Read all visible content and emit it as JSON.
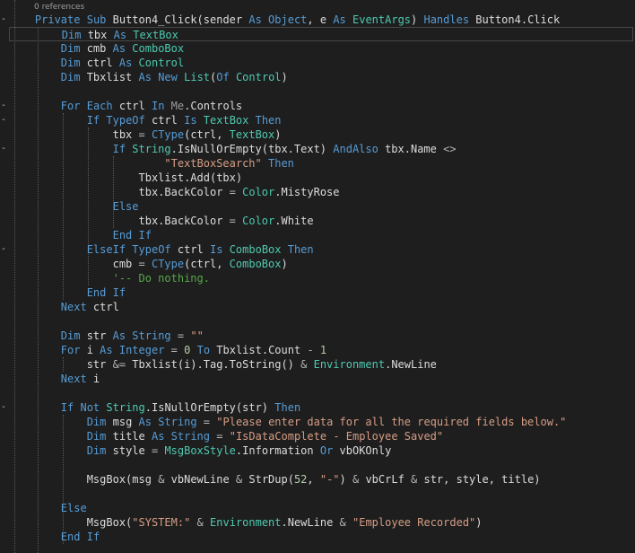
{
  "codelens": {
    "references": "0 references"
  },
  "colors": {
    "background": "#1e1e1e",
    "keyword": "#569cd6",
    "type": "#4ec9b0",
    "string": "#d69d85",
    "comment": "#57a64a",
    "number": "#b5cea8",
    "text": "#dcdcdc",
    "operator": "#b4b4b4"
  },
  "collapse_markers": [
    "-",
    "-",
    "-",
    "-",
    "-",
    "-"
  ],
  "code": {
    "lines": [
      {
        "indent": "    ",
        "tokens": [
          {
            "t": "Private",
            "c": "kw"
          },
          {
            "t": " "
          },
          {
            "t": "Sub",
            "c": "kw"
          },
          {
            "t": " Button4_Click(sender "
          },
          {
            "t": "As",
            "c": "kw"
          },
          {
            "t": " "
          },
          {
            "t": "Object",
            "c": "kw"
          },
          {
            "t": ", e "
          },
          {
            "t": "As",
            "c": "kw"
          },
          {
            "t": " "
          },
          {
            "t": "EventArgs",
            "c": "ty"
          },
          {
            "t": ") "
          },
          {
            "t": "Handles",
            "c": "kw"
          },
          {
            "t": " Button4.Click"
          }
        ]
      },
      {
        "indent": "        ",
        "current": true,
        "tokens": [
          {
            "t": "Dim",
            "c": "kw"
          },
          {
            "t": " tbx "
          },
          {
            "t": "As",
            "c": "kw"
          },
          {
            "t": " "
          },
          {
            "t": "TextBox",
            "c": "ty"
          }
        ]
      },
      {
        "indent": "        ",
        "tokens": [
          {
            "t": "Dim",
            "c": "kw"
          },
          {
            "t": " cmb "
          },
          {
            "t": "As",
            "c": "kw"
          },
          {
            "t": " "
          },
          {
            "t": "ComboBox",
            "c": "ty"
          }
        ]
      },
      {
        "indent": "        ",
        "tokens": [
          {
            "t": "Dim",
            "c": "kw"
          },
          {
            "t": " ctrl "
          },
          {
            "t": "As",
            "c": "kw"
          },
          {
            "t": " "
          },
          {
            "t": "Control",
            "c": "ty"
          }
        ]
      },
      {
        "indent": "        ",
        "tokens": [
          {
            "t": "Dim",
            "c": "kw"
          },
          {
            "t": " Tbxlist "
          },
          {
            "t": "As",
            "c": "kw"
          },
          {
            "t": " "
          },
          {
            "t": "New",
            "c": "kw"
          },
          {
            "t": " "
          },
          {
            "t": "List",
            "c": "ty"
          },
          {
            "t": "("
          },
          {
            "t": "Of",
            "c": "kw"
          },
          {
            "t": " "
          },
          {
            "t": "Control",
            "c": "ty"
          },
          {
            "t": ")"
          }
        ]
      },
      {
        "indent": "",
        "tokens": []
      },
      {
        "indent": "        ",
        "tokens": [
          {
            "t": "For",
            "c": "kw"
          },
          {
            "t": " "
          },
          {
            "t": "Each",
            "c": "kw"
          },
          {
            "t": " ctrl "
          },
          {
            "t": "In",
            "c": "kw"
          },
          {
            "t": " "
          },
          {
            "t": "Me",
            "c": "me"
          },
          {
            "t": ".Controls"
          }
        ]
      },
      {
        "indent": "            ",
        "tokens": [
          {
            "t": "If",
            "c": "kw"
          },
          {
            "t": " "
          },
          {
            "t": "TypeOf",
            "c": "kw"
          },
          {
            "t": " ctrl "
          },
          {
            "t": "Is",
            "c": "kw"
          },
          {
            "t": " "
          },
          {
            "t": "TextBox",
            "c": "ty"
          },
          {
            "t": " "
          },
          {
            "t": "Then",
            "c": "kw"
          }
        ]
      },
      {
        "indent": "                ",
        "tokens": [
          {
            "t": "tbx "
          },
          {
            "t": "=",
            "c": "op"
          },
          {
            "t": " "
          },
          {
            "t": "CType",
            "c": "kw"
          },
          {
            "t": "(ctrl, "
          },
          {
            "t": "TextBox",
            "c": "ty"
          },
          {
            "t": ")"
          }
        ]
      },
      {
        "indent": "                ",
        "tokens": [
          {
            "t": "If",
            "c": "kw"
          },
          {
            "t": " "
          },
          {
            "t": "String",
            "c": "ty"
          },
          {
            "t": ".IsNullOrEmpty(tbx.Text) "
          },
          {
            "t": "AndAlso",
            "c": "kw"
          },
          {
            "t": " tbx.Name "
          },
          {
            "t": "<>",
            "c": "op"
          }
        ]
      },
      {
        "indent": "                        ",
        "tokens": [
          {
            "t": "\"TextBoxSearch\"",
            "c": "st"
          },
          {
            "t": " "
          },
          {
            "t": "Then",
            "c": "kw"
          }
        ]
      },
      {
        "indent": "                    ",
        "tokens": [
          {
            "t": "Tbxlist.Add(tbx)"
          }
        ]
      },
      {
        "indent": "                    ",
        "tokens": [
          {
            "t": "tbx.BackColor "
          },
          {
            "t": "=",
            "c": "op"
          },
          {
            "t": " "
          },
          {
            "t": "Color",
            "c": "ty"
          },
          {
            "t": ".MistyRose"
          }
        ]
      },
      {
        "indent": "                ",
        "tokens": [
          {
            "t": "Else",
            "c": "kw"
          }
        ]
      },
      {
        "indent": "                    ",
        "tokens": [
          {
            "t": "tbx.BackColor "
          },
          {
            "t": "=",
            "c": "op"
          },
          {
            "t": " "
          },
          {
            "t": "Color",
            "c": "ty"
          },
          {
            "t": ".White"
          }
        ]
      },
      {
        "indent": "                ",
        "tokens": [
          {
            "t": "End",
            "c": "kw"
          },
          {
            "t": " "
          },
          {
            "t": "If",
            "c": "kw"
          }
        ]
      },
      {
        "indent": "            ",
        "tokens": [
          {
            "t": "ElseIf",
            "c": "kw"
          },
          {
            "t": " "
          },
          {
            "t": "TypeOf",
            "c": "kw"
          },
          {
            "t": " ctrl "
          },
          {
            "t": "Is",
            "c": "kw"
          },
          {
            "t": " "
          },
          {
            "t": "ComboBox",
            "c": "ty"
          },
          {
            "t": " "
          },
          {
            "t": "Then",
            "c": "kw"
          }
        ]
      },
      {
        "indent": "                ",
        "tokens": [
          {
            "t": "cmb "
          },
          {
            "t": "=",
            "c": "op"
          },
          {
            "t": " "
          },
          {
            "t": "CType",
            "c": "kw"
          },
          {
            "t": "(ctrl, "
          },
          {
            "t": "ComboBox",
            "c": "ty"
          },
          {
            "t": ")"
          }
        ]
      },
      {
        "indent": "                ",
        "tokens": [
          {
            "t": "'-- Do nothing.",
            "c": "cm"
          }
        ]
      },
      {
        "indent": "            ",
        "tokens": [
          {
            "t": "End",
            "c": "kw"
          },
          {
            "t": " "
          },
          {
            "t": "If",
            "c": "kw"
          }
        ]
      },
      {
        "indent": "        ",
        "tokens": [
          {
            "t": "Next",
            "c": "kw"
          },
          {
            "t": " ctrl"
          }
        ]
      },
      {
        "indent": "",
        "tokens": []
      },
      {
        "indent": "        ",
        "tokens": [
          {
            "t": "Dim",
            "c": "kw"
          },
          {
            "t": " str "
          },
          {
            "t": "As",
            "c": "kw"
          },
          {
            "t": " "
          },
          {
            "t": "String",
            "c": "kw"
          },
          {
            "t": " "
          },
          {
            "t": "=",
            "c": "op"
          },
          {
            "t": " "
          },
          {
            "t": "\"\"",
            "c": "st"
          }
        ]
      },
      {
        "indent": "        ",
        "tokens": [
          {
            "t": "For",
            "c": "kw"
          },
          {
            "t": " i "
          },
          {
            "t": "As",
            "c": "kw"
          },
          {
            "t": " "
          },
          {
            "t": "Integer",
            "c": "kw"
          },
          {
            "t": " "
          },
          {
            "t": "=",
            "c": "op"
          },
          {
            "t": " "
          },
          {
            "t": "0",
            "c": "nm"
          },
          {
            "t": " "
          },
          {
            "t": "To",
            "c": "kw"
          },
          {
            "t": " Tbxlist.Count "
          },
          {
            "t": "-",
            "c": "op"
          },
          {
            "t": " "
          },
          {
            "t": "1",
            "c": "nm"
          }
        ]
      },
      {
        "indent": "            ",
        "tokens": [
          {
            "t": "str "
          },
          {
            "t": "&=",
            "c": "op"
          },
          {
            "t": " Tbxlist(i).Tag.ToString() "
          },
          {
            "t": "&",
            "c": "op"
          },
          {
            "t": " "
          },
          {
            "t": "Environment",
            "c": "ty"
          },
          {
            "t": ".NewLine"
          }
        ]
      },
      {
        "indent": "        ",
        "tokens": [
          {
            "t": "Next",
            "c": "kw"
          },
          {
            "t": " i"
          }
        ]
      },
      {
        "indent": "",
        "tokens": []
      },
      {
        "indent": "        ",
        "tokens": [
          {
            "t": "If",
            "c": "kw"
          },
          {
            "t": " "
          },
          {
            "t": "Not",
            "c": "kw"
          },
          {
            "t": " "
          },
          {
            "t": "String",
            "c": "ty"
          },
          {
            "t": ".IsNullOrEmpty(str) "
          },
          {
            "t": "Then",
            "c": "kw"
          }
        ]
      },
      {
        "indent": "            ",
        "tokens": [
          {
            "t": "Dim",
            "c": "kw"
          },
          {
            "t": " msg "
          },
          {
            "t": "As",
            "c": "kw"
          },
          {
            "t": " "
          },
          {
            "t": "String",
            "c": "kw"
          },
          {
            "t": " "
          },
          {
            "t": "=",
            "c": "op"
          },
          {
            "t": " "
          },
          {
            "t": "\"Please enter data for all the required fields below.\"",
            "c": "st"
          }
        ]
      },
      {
        "indent": "            ",
        "tokens": [
          {
            "t": "Dim",
            "c": "kw"
          },
          {
            "t": " title "
          },
          {
            "t": "As",
            "c": "kw"
          },
          {
            "t": " "
          },
          {
            "t": "String",
            "c": "kw"
          },
          {
            "t": " "
          },
          {
            "t": "=",
            "c": "op"
          },
          {
            "t": " "
          },
          {
            "t": "\"IsDataComplete - Employee Saved\"",
            "c": "st"
          }
        ]
      },
      {
        "indent": "            ",
        "tokens": [
          {
            "t": "Dim",
            "c": "kw"
          },
          {
            "t": " style "
          },
          {
            "t": "=",
            "c": "op"
          },
          {
            "t": " "
          },
          {
            "t": "MsgBoxStyle",
            "c": "ty"
          },
          {
            "t": ".Information "
          },
          {
            "t": "Or",
            "c": "kw"
          },
          {
            "t": " vbOKOnly"
          }
        ]
      },
      {
        "indent": "",
        "tokens": []
      },
      {
        "indent": "            ",
        "tokens": [
          {
            "t": "MsgBox(msg "
          },
          {
            "t": "&",
            "c": "op"
          },
          {
            "t": " vbNewLine "
          },
          {
            "t": "&",
            "c": "op"
          },
          {
            "t": " StrDup("
          },
          {
            "t": "52",
            "c": "nm"
          },
          {
            "t": ", "
          },
          {
            "t": "\"-\"",
            "c": "st"
          },
          {
            "t": ") "
          },
          {
            "t": "&",
            "c": "op"
          },
          {
            "t": " vbCrLf "
          },
          {
            "t": "&",
            "c": "op"
          },
          {
            "t": " str, style, title)"
          }
        ]
      },
      {
        "indent": "",
        "tokens": []
      },
      {
        "indent": "        ",
        "tokens": [
          {
            "t": "Else",
            "c": "kw"
          }
        ]
      },
      {
        "indent": "            ",
        "tokens": [
          {
            "t": "MsgBox("
          },
          {
            "t": "\"SYSTEM:\"",
            "c": "st"
          },
          {
            "t": " "
          },
          {
            "t": "&",
            "c": "op"
          },
          {
            "t": " "
          },
          {
            "t": "Environment",
            "c": "ty"
          },
          {
            "t": ".NewLine "
          },
          {
            "t": "&",
            "c": "op"
          },
          {
            "t": " "
          },
          {
            "t": "\"Employee Recorded\"",
            "c": "st"
          },
          {
            "t": ")"
          }
        ]
      },
      {
        "indent": "        ",
        "tokens": [
          {
            "t": "End",
            "c": "kw"
          },
          {
            "t": " "
          },
          {
            "t": "If",
            "c": "kw"
          }
        ]
      }
    ]
  }
}
